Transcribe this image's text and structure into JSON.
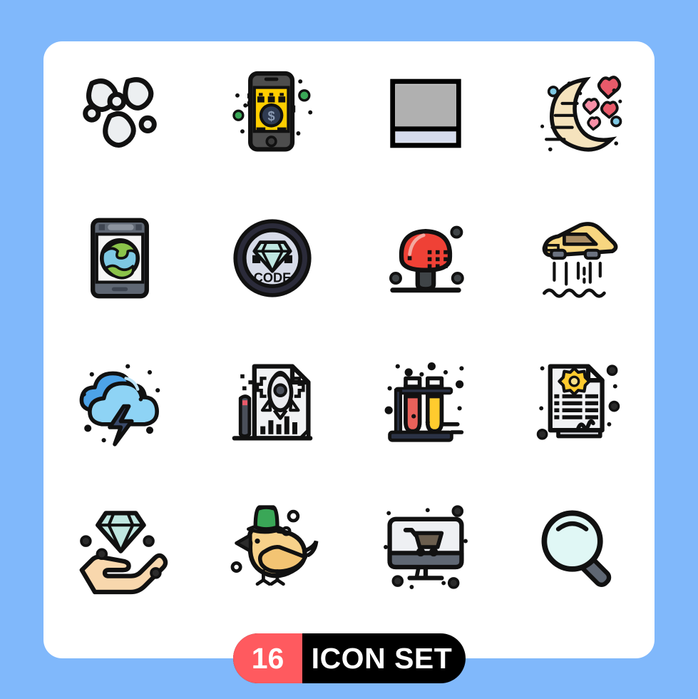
{
  "canvas": {
    "background_color": "#80b8fb",
    "card_color": "#ffffff"
  },
  "badge": {
    "count": "16",
    "label": "ICON SET",
    "count_bg_color": "#ff5a5f",
    "label_bg_color": "#000000",
    "text_color": "#ffffff"
  },
  "grid": {
    "columns": 4,
    "rows": 4,
    "total": 16
  },
  "icons": [
    {
      "name": "bubbles-icon",
      "title": "Bubbles",
      "row": 1,
      "col": 1,
      "colors": [
        "#eceff1",
        "#000000"
      ]
    },
    {
      "name": "mobile-funding-icon",
      "title": "Mobile Funding",
      "row": 1,
      "col": 2,
      "colors": [
        "#ffce00",
        "#4d4d4d",
        "#2f3b52",
        "#3aa757"
      ]
    },
    {
      "name": "layout-frame-icon",
      "title": "Layout",
      "row": 1,
      "col": 3,
      "colors": [
        "#b0b0b0",
        "#d6dced",
        "#000000"
      ]
    },
    {
      "name": "moon-hearts-icon",
      "title": "Romantic Night",
      "row": 1,
      "col": 4,
      "colors": [
        "#f5e3bd",
        "#e85a6a",
        "#f78fa7",
        "#7ec8e3"
      ]
    },
    {
      "name": "tablet-globe-icon",
      "title": "Global Mobile",
      "row": 2,
      "col": 1,
      "colors": [
        "#5f6773",
        "#7ec8e3",
        "#8bc34a"
      ]
    },
    {
      "name": "code-badge-icon",
      "title": "Code",
      "row": 2,
      "col": 2,
      "label": "CODE",
      "colors": [
        "#2b2b3a",
        "#d7dbe8",
        "#bfe6e0"
      ]
    },
    {
      "name": "mushroom-icon",
      "title": "Mushroom",
      "row": 2,
      "col": 3,
      "colors": [
        "#ef4136",
        "#3f4447"
      ]
    },
    {
      "name": "flying-car-icon",
      "title": "Flying Car",
      "row": 2,
      "col": 4,
      "colors": [
        "#f7d680",
        "#a98c63",
        "#6b7280"
      ]
    },
    {
      "name": "storm-cloud-icon",
      "title": "Brainstorm",
      "row": 3,
      "col": 1,
      "colors": [
        "#4da3e8",
        "#8ed3f5",
        "#3a4a6b"
      ]
    },
    {
      "name": "rocket-document-icon",
      "title": "Launch Plan",
      "row": 3,
      "col": 2,
      "colors": [
        "#f1f2f4",
        "#d7d9e0",
        "#e85a6a",
        "#4a4f5a"
      ]
    },
    {
      "name": "test-tubes-icon",
      "title": "Test Tubes",
      "row": 3,
      "col": 3,
      "colors": [
        "#e8615a",
        "#ffcb2e",
        "#2b3245"
      ]
    },
    {
      "name": "certificate-icon",
      "title": "Certificate",
      "row": 3,
      "col": 4,
      "colors": [
        "#f1f2f4",
        "#ffcb2e",
        "#000000"
      ]
    },
    {
      "name": "diamond-hand-icon",
      "title": "Benefit",
      "row": 4,
      "col": 1,
      "colors": [
        "#bfe6e0",
        "#f8d7ad",
        "#000000"
      ]
    },
    {
      "name": "bird-hat-icon",
      "title": "Bird",
      "row": 4,
      "col": 2,
      "colors": [
        "#f7d18a",
        "#3aa757",
        "#5f6773"
      ]
    },
    {
      "name": "online-shopping-icon",
      "title": "Online Shopping",
      "row": 4,
      "col": 3,
      "colors": [
        "#eef0f3",
        "#5f6773",
        "#6b5e4e"
      ]
    },
    {
      "name": "magnifier-icon",
      "title": "Search",
      "row": 4,
      "col": 4,
      "colors": [
        "#e0f7f5",
        "#5f6773",
        "#000000"
      ]
    }
  ]
}
